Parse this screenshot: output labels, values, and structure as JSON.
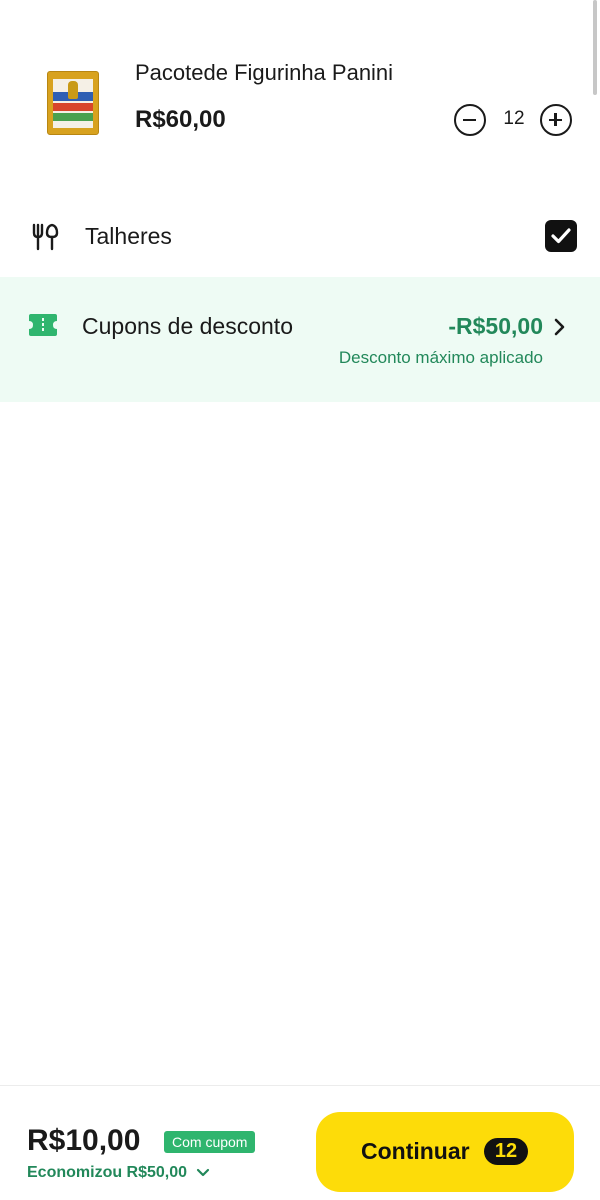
{
  "product": {
    "name": "Pacotede Figurinha Panini",
    "price": "R$60,00",
    "quantity": "12"
  },
  "cutlery": {
    "label": "Talheres",
    "checked": true
  },
  "coupon": {
    "label": "Cupons de desconto",
    "value": "-R$50,00",
    "subtitle": "Desconto máximo aplicado"
  },
  "footer": {
    "total": "R$10,00",
    "badge": "Com cupom",
    "savings": "Economizou R$50,00",
    "continue_label": "Continuar",
    "continue_count": "12"
  },
  "colors": {
    "accent_yellow": "#fddc09",
    "green": "#22885a",
    "coupon_bg": "#eefbf4",
    "badge_green": "#2fb56e"
  },
  "icons": [
    "fork-knife-icon",
    "ticket-icon",
    "chevron-right-icon",
    "chevron-down-icon",
    "minus-icon",
    "plus-icon",
    "check-icon"
  ]
}
